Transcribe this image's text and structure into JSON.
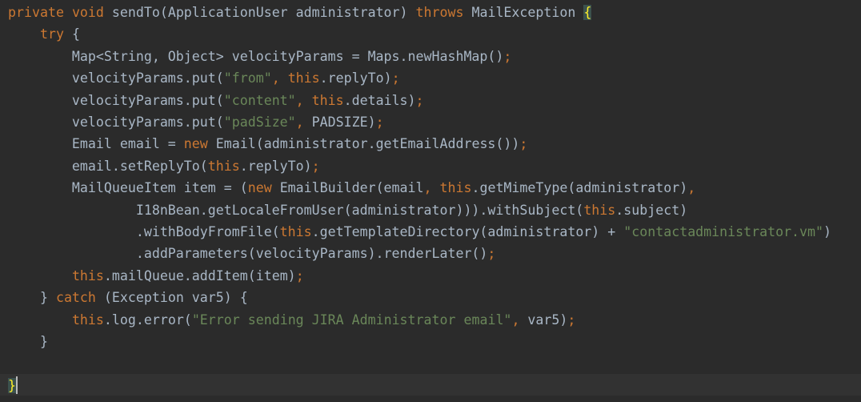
{
  "editor": {
    "lines": [
      [
        [
          "kw",
          "private "
        ],
        [
          "kw",
          "void "
        ],
        [
          "plain",
          "sendTo(ApplicationUser administrator) "
        ],
        [
          "kw",
          "throws "
        ],
        [
          "plain",
          "MailException "
        ],
        [
          "brace-match",
          "{"
        ]
      ],
      [
        [
          "plain",
          "    "
        ],
        [
          "kw",
          "try "
        ],
        [
          "plain",
          "{"
        ]
      ],
      [
        [
          "plain",
          "        Map<String, Object> velocityParams = Maps.newHashMap()"
        ],
        [
          "kw",
          ";"
        ]
      ],
      [
        [
          "plain",
          "        velocityParams.put("
        ],
        [
          "str",
          "\"from\""
        ],
        [
          "kw",
          ", "
        ],
        [
          "kw",
          "this"
        ],
        [
          "plain",
          ".replyTo)"
        ],
        [
          "kw",
          ";"
        ]
      ],
      [
        [
          "plain",
          "        velocityParams.put("
        ],
        [
          "str",
          "\"content\""
        ],
        [
          "kw",
          ", "
        ],
        [
          "kw",
          "this"
        ],
        [
          "plain",
          ".details)"
        ],
        [
          "kw",
          ";"
        ]
      ],
      [
        [
          "plain",
          "        velocityParams.put("
        ],
        [
          "str",
          "\"padSize\""
        ],
        [
          "kw",
          ", "
        ],
        [
          "plain",
          "PADSIZE)"
        ],
        [
          "kw",
          ";"
        ]
      ],
      [
        [
          "plain",
          "        Email email = "
        ],
        [
          "kw",
          "new "
        ],
        [
          "plain",
          "Email(administrator.getEmailAddress())"
        ],
        [
          "kw",
          ";"
        ]
      ],
      [
        [
          "plain",
          "        email.setReplyTo("
        ],
        [
          "kw",
          "this"
        ],
        [
          "plain",
          ".replyTo)"
        ],
        [
          "kw",
          ";"
        ]
      ],
      [
        [
          "plain",
          "        MailQueueItem item = ("
        ],
        [
          "kw",
          "new "
        ],
        [
          "plain",
          "EmailBuilder(email"
        ],
        [
          "kw",
          ", "
        ],
        [
          "kw",
          "this"
        ],
        [
          "plain",
          ".getMimeType(administrator)"
        ],
        [
          "kw",
          ","
        ]
      ],
      [
        [
          "plain",
          "                I18nBean.getLocaleFromUser(administrator))).withSubject("
        ],
        [
          "kw",
          "this"
        ],
        [
          "plain",
          ".subject)"
        ]
      ],
      [
        [
          "plain",
          "                .withBodyFromFile("
        ],
        [
          "kw",
          "this"
        ],
        [
          "plain",
          ".getTemplateDirectory(administrator) + "
        ],
        [
          "str",
          "\"contactadministrator.vm\""
        ],
        [
          "plain",
          ")"
        ]
      ],
      [
        [
          "plain",
          "                .addParameters(velocityParams).renderLater()"
        ],
        [
          "kw",
          ";"
        ]
      ],
      [
        [
          "plain",
          "        "
        ],
        [
          "kw",
          "this"
        ],
        [
          "plain",
          ".mailQueue.addItem(item)"
        ],
        [
          "kw",
          ";"
        ]
      ],
      [
        [
          "plain",
          "    } "
        ],
        [
          "kw",
          "catch "
        ],
        [
          "plain",
          "(Exception var5) {"
        ]
      ],
      [
        [
          "plain",
          "        "
        ],
        [
          "kw",
          "this"
        ],
        [
          "plain",
          ".log.error("
        ],
        [
          "str",
          "\"Error sending JIRA Administrator email\""
        ],
        [
          "kw",
          ", "
        ],
        [
          "plain",
          "var5)"
        ],
        [
          "kw",
          ";"
        ]
      ],
      [
        [
          "plain",
          "    }"
        ]
      ],
      [
        [
          "plain",
          ""
        ]
      ],
      [
        [
          "brace-match",
          "}"
        ]
      ]
    ]
  }
}
